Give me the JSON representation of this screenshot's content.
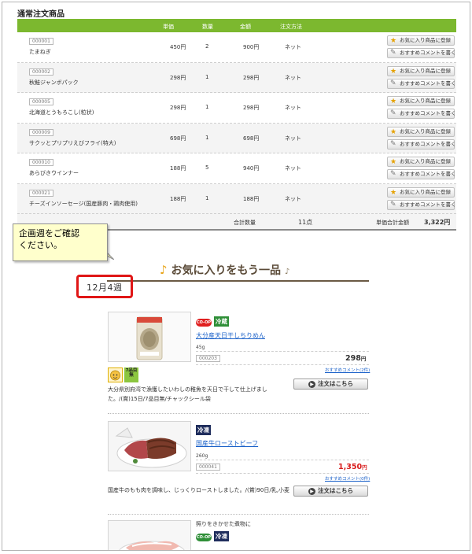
{
  "order_section": {
    "title": "通常注文商品",
    "headers": {
      "price": "単価",
      "qty": "数量",
      "amount": "金額",
      "method": "注文方法"
    },
    "fav_button_label": "お気に入り商品に登録",
    "recommend_button_label": "おすすめコメントを書く",
    "rows": [
      {
        "code": "000001",
        "name": "たまねぎ",
        "price": "450円",
        "qty": "2",
        "amount": "900円",
        "method": "ネット"
      },
      {
        "code": "000002",
        "name": "秋鮭ジャンボパック",
        "price": "298円",
        "qty": "1",
        "amount": "298円",
        "method": "ネット"
      },
      {
        "code": "000005",
        "name": "北海道とうもろこし(粒状)",
        "price": "298円",
        "qty": "1",
        "amount": "298円",
        "method": "ネット"
      },
      {
        "code": "000009",
        "name": "サクッとプリプリえびフライ(特大)",
        "price": "698円",
        "qty": "1",
        "amount": "698円",
        "method": "ネット"
      },
      {
        "code": "000010",
        "name": "あらびきウインナー",
        "price": "188円",
        "qty": "5",
        "amount": "940円",
        "method": "ネット"
      },
      {
        "code": "000021",
        "name": "チーズインソーセージ(国産豚肉・鶏肉使用)",
        "price": "188円",
        "qty": "1",
        "amount": "188円",
        "method": "ネット"
      }
    ],
    "totals": {
      "qty_label": "合計数量",
      "qty_value": "11点",
      "amount_label": "単価合計金額",
      "amount_value": "3,322円"
    }
  },
  "callout": {
    "text": "企画週をご確認\nください。"
  },
  "recommend_section": {
    "title": "お気に入りをもう一品",
    "week": "12月4週",
    "order_button_label": "注文はこちら",
    "products": [
      {
        "coop_logo": "CO-OP",
        "tag": "冷蔵",
        "name": "大分産天日干しちりめん",
        "weight": "45g",
        "code": "000203",
        "price": "298",
        "price_unit": "円",
        "price_color": "#000000",
        "comment_link": "おすすめコメント(2件)",
        "badge_text": "7品目",
        "badge_sub": "無",
        "description": "大分県別府湾で漁獲したいわしの稚魚を天日で干して仕上げました。/(賞)15日/7品目無/チャックシール袋"
      },
      {
        "tag": "冷凍",
        "name": "国産牛ローストビーフ",
        "weight": "260g",
        "code": "000041",
        "price": "1,350",
        "price_unit": "円",
        "price_color": "#d81b1b",
        "comment_link": "おすすめコメント(0件)",
        "description": "国産牛のもも肉を調味し、じっくりローストしました。/(賞)90日/乳,小麦"
      },
      {
        "tagline": "照りをきかせた煮物に",
        "coop_logo": "CO-OP",
        "tag": "冷凍"
      }
    ]
  },
  "colors": {
    "header_green": "#7cb82f",
    "link_blue": "#1a61c9",
    "highlight_red": "#e01616"
  }
}
